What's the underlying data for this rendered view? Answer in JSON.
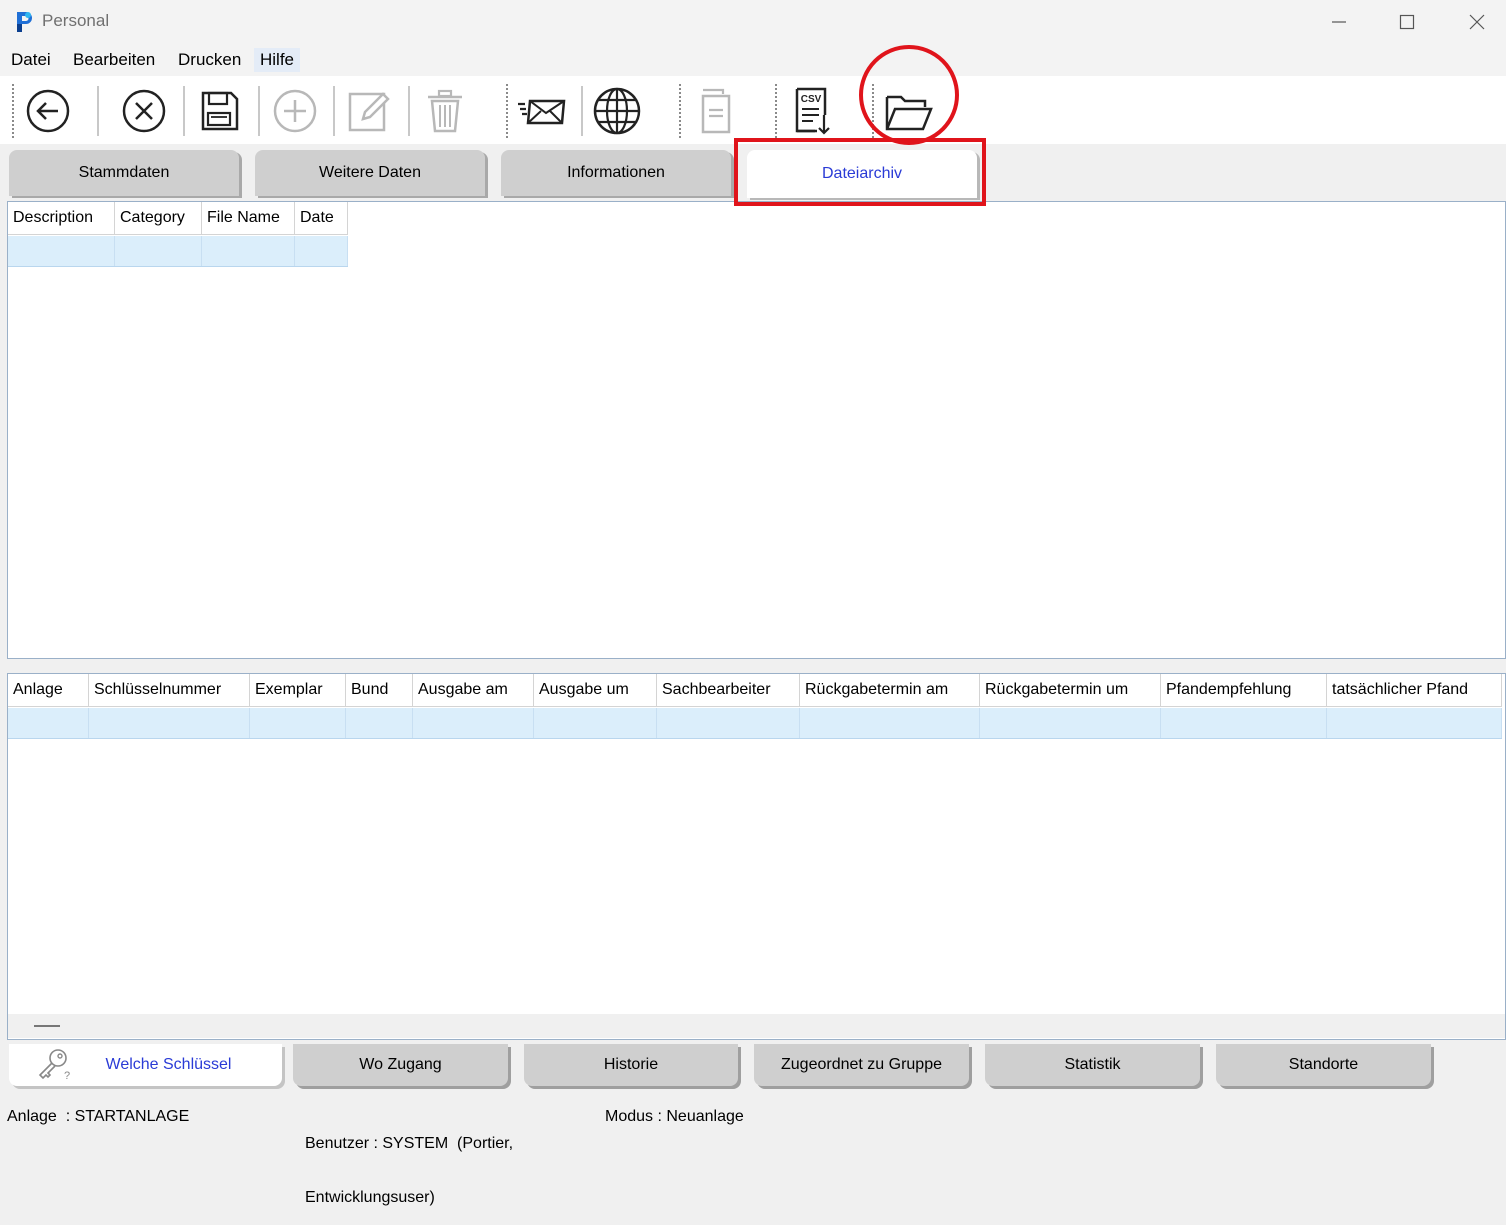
{
  "window": {
    "title": "Personal"
  },
  "menu": [
    "Datei",
    "Bearbeiten",
    "Drucken",
    "Hilfe"
  ],
  "toolbar": {
    "buttons": [
      {
        "name": "back-icon"
      },
      {
        "name": "cancel-icon"
      },
      {
        "name": "save-icon"
      },
      {
        "name": "add-icon"
      },
      {
        "name": "edit-icon"
      },
      {
        "name": "delete-icon"
      },
      {
        "name": "email-icon"
      },
      {
        "name": "globe-icon"
      },
      {
        "name": "copy-document-icon"
      },
      {
        "name": "csv-export-icon",
        "label": "CSV"
      },
      {
        "name": "open-folder-icon"
      }
    ]
  },
  "tabs": [
    "Stammdaten",
    "Weitere Daten",
    "Informationen",
    "Dateiarchiv"
  ],
  "active_tab": "Dateiarchiv",
  "file_grid": {
    "columns": [
      "Description",
      "Category",
      "File Name",
      "Date"
    ],
    "rows": [
      [
        "",
        "",
        "",
        ""
      ]
    ]
  },
  "key_grid": {
    "columns": [
      "Anlage",
      "Schlüsselnummer",
      "Exemplar",
      "Bund",
      "Ausgabe am",
      "Ausgabe um",
      "Sachbearbeiter",
      "Rückgabetermin am",
      "Rückgabetermin um",
      "Pfandempfehlung",
      "tatsächlicher Pfand"
    ],
    "rows": [
      [
        "",
        "",
        "",
        "",
        "",
        "",
        "",
        "",
        "",
        "",
        ""
      ]
    ]
  },
  "bottom_tabs": [
    "Welche Schlüssel",
    "Wo Zugang",
    "Historie",
    "Zugeordnet zu Gruppe",
    "Statistik",
    "Standorte"
  ],
  "active_bottom_tab": "Welche Schlüssel",
  "status": {
    "anlage": "Anlage  : STARTANLAGE",
    "benutzer_line1": "Benutzer : SYSTEM  (Portier,",
    "benutzer_line2": "Entwicklungsuser)",
    "modus": "Modus : Neuanlage"
  },
  "colors": {
    "highlight": "#e0141b",
    "active_tab_text": "#2a3bd6",
    "selected_row": "#dbeefb"
  }
}
